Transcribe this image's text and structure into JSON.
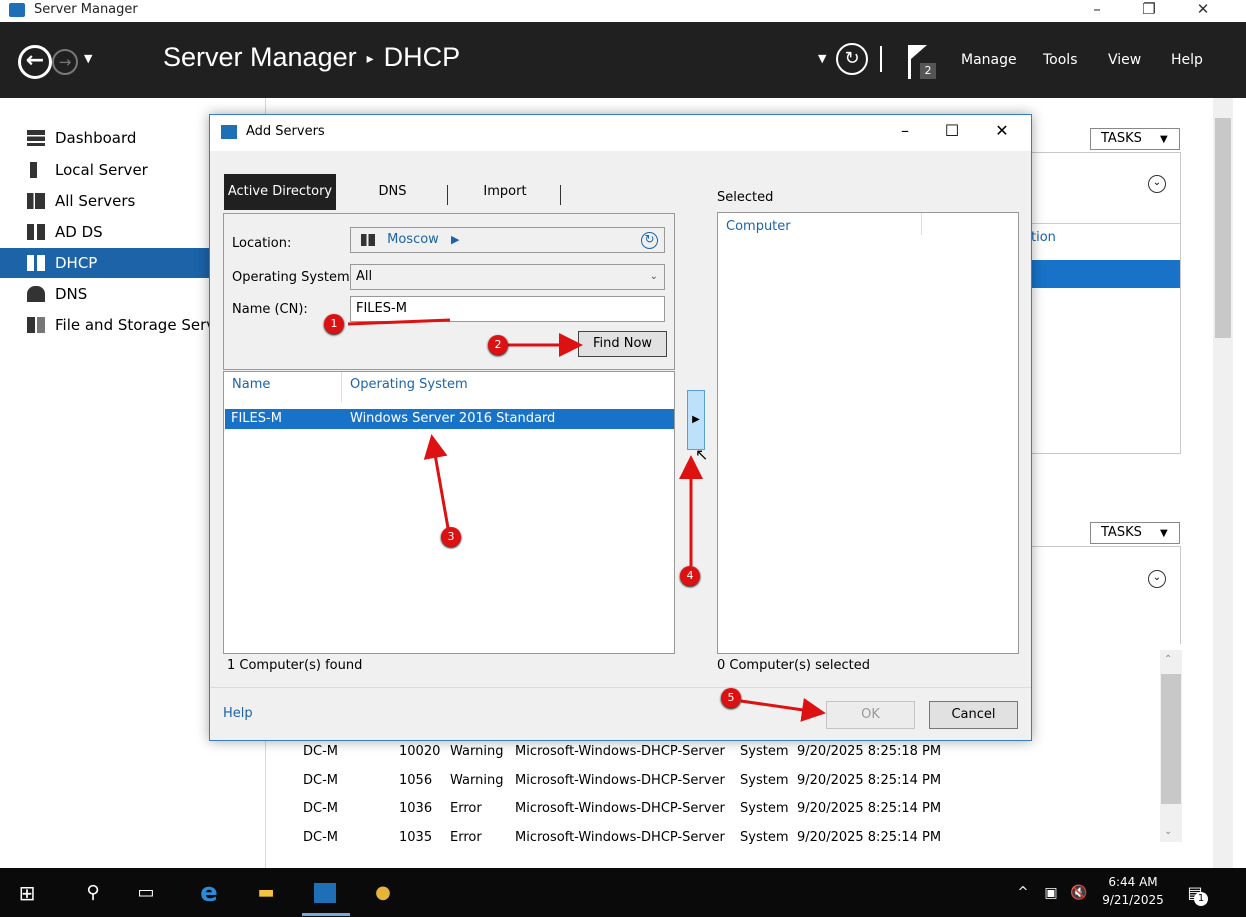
{
  "window": {
    "title": "Server Manager",
    "min": "–",
    "max": "❐",
    "close": "✕"
  },
  "header": {
    "app": "Server Manager",
    "separator": "▸",
    "section": "DHCP",
    "notification_count": "2",
    "menus": [
      "Manage",
      "Tools",
      "View",
      "Help"
    ]
  },
  "sidebar": {
    "items": [
      {
        "label": "Dashboard",
        "icon": "dashboard-icon"
      },
      {
        "label": "Local Server",
        "icon": "server-icon"
      },
      {
        "label": "All Servers",
        "icon": "servers-icon"
      },
      {
        "label": "AD DS",
        "icon": "adds-icon"
      },
      {
        "label": "DHCP",
        "icon": "dhcp-icon"
      },
      {
        "label": "DNS",
        "icon": "dns-icon"
      },
      {
        "label": "File and Storage Serv",
        "icon": "storage-icon"
      }
    ]
  },
  "main": {
    "tasks_label": "TASKS",
    "partial_column": "tion",
    "events": [
      {
        "server": "DC-M",
        "id": "10020",
        "severity": "Warning",
        "source": "Microsoft-Windows-DHCP-Server",
        "log": "System",
        "date": "9/20/2025 8:25:18 PM"
      },
      {
        "server": "DC-M",
        "id": "1056",
        "severity": "Warning",
        "source": "Microsoft-Windows-DHCP-Server",
        "log": "System",
        "date": "9/20/2025 8:25:14 PM"
      },
      {
        "server": "DC-M",
        "id": "1036",
        "severity": "Error",
        "source": "Microsoft-Windows-DHCP-Server",
        "log": "System",
        "date": "9/20/2025 8:25:14 PM"
      },
      {
        "server": "DC-M",
        "id": "1035",
        "severity": "Error",
        "source": "Microsoft-Windows-DHCP-Server",
        "log": "System",
        "date": "9/20/2025 8:25:14 PM"
      }
    ]
  },
  "dialog": {
    "title": "Add Servers",
    "tabs": [
      "Active Directory",
      "DNS",
      "Import"
    ],
    "location_label": "Location:",
    "location_value": "Moscow",
    "os_label": "Operating System:",
    "os_value": "All",
    "name_label": "Name (CN):",
    "name_value": "FILES-M",
    "find_now": "Find Now",
    "results_columns": [
      "Name",
      "Operating System"
    ],
    "result_row": {
      "name": "FILES-M",
      "os": "Windows Server 2016 Standard"
    },
    "found_count": "1 Computer(s) found",
    "selected_label": "Selected",
    "selected_column": "Computer",
    "selected_count": "0 Computer(s) selected",
    "help": "Help",
    "ok": "OK",
    "cancel": "Cancel"
  },
  "annotations": [
    "1",
    "2",
    "3",
    "4",
    "5"
  ],
  "taskbar": {
    "time": "6:44 AM",
    "date": "9/21/2025",
    "notification_badge": "1"
  }
}
